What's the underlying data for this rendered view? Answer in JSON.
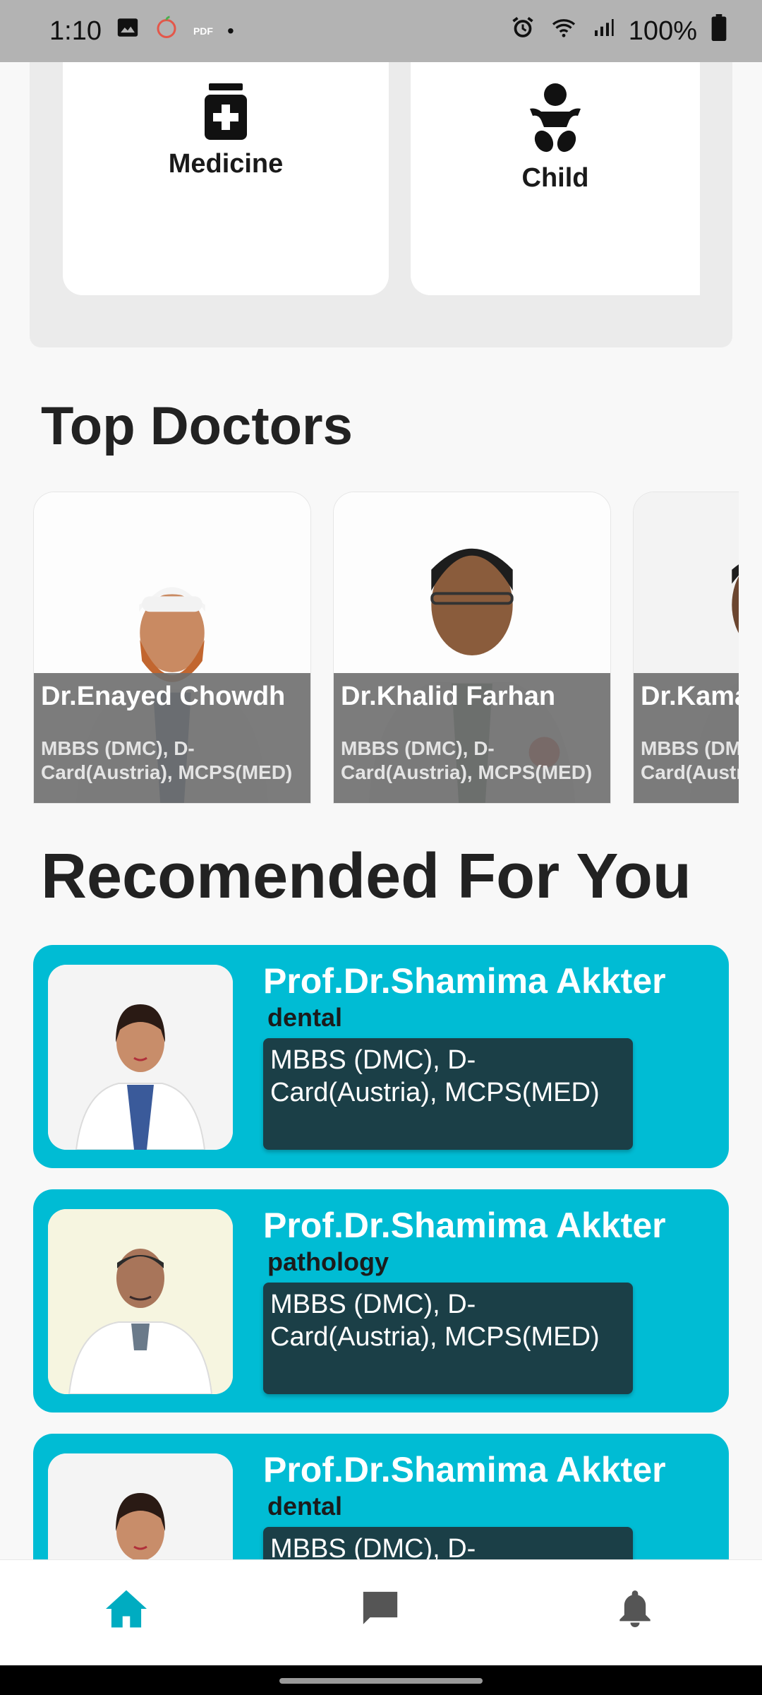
{
  "status_bar": {
    "time": "1:10",
    "pdf_label": "PDF",
    "dot": "•",
    "battery": "100%",
    "icons": [
      "gallery-icon",
      "fruit-app-icon",
      "pdf-icon",
      "alarm-icon",
      "wifi-icon",
      "signal-icon",
      "battery-icon"
    ]
  },
  "categories": [
    {
      "label": "Medicine",
      "icon": "medicine-icon"
    },
    {
      "label": "Child",
      "icon": "child-icon"
    }
  ],
  "top_doctors": {
    "title": "Top Doctors",
    "items": [
      {
        "name": "Dr.Enayed Chowdh",
        "degree": "MBBS (DMC), D-Card(Austria), MCPS(MED)"
      },
      {
        "name": "Dr.Khalid Farhan",
        "degree": "MBBS (DMC), D-Card(Austria), MCPS(MED)"
      },
      {
        "name": "Dr.Kamal",
        "degree": "MBBS (DMC), D-Card(Austria), MCPS(MED)"
      }
    ]
  },
  "recommended": {
    "title": "Recomended For You",
    "items": [
      {
        "name": "Prof.Dr.Shamima Akkter",
        "specialty": "dental",
        "degree": "MBBS (DMC), D-Card(Austria), MCPS(MED)"
      },
      {
        "name": "Prof.Dr.Shamima Akkter",
        "specialty": "pathology",
        "degree": "MBBS (DMC), D-Card(Austria), MCPS(MED)"
      },
      {
        "name": "Prof.Dr.Shamima Akkter",
        "specialty": "dental",
        "degree": "MBBS (DMC), D-Card(Austria), MCPS(MED)"
      }
    ]
  },
  "bottom_nav": {
    "items": [
      {
        "name": "home",
        "icon": "home-icon",
        "active": true
      },
      {
        "name": "chat",
        "icon": "chat-icon",
        "active": false
      },
      {
        "name": "notifications",
        "icon": "bell-icon",
        "active": false
      }
    ]
  },
  "colors": {
    "accent": "#00bcd4",
    "degree_box": "#1b3f47",
    "overlay": "#6e6e6e",
    "inactive_icon": "#555555"
  }
}
